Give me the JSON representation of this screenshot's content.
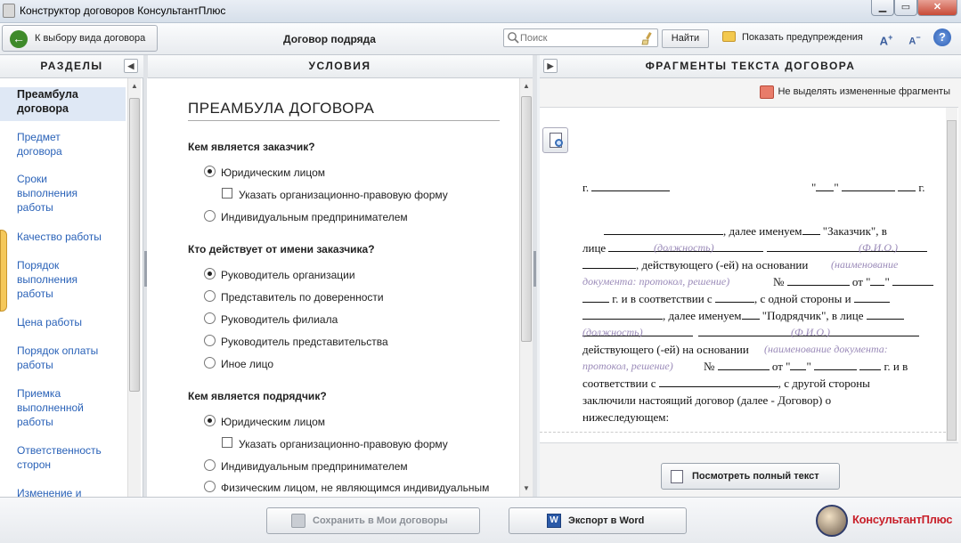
{
  "window": {
    "title": "Конструктор договоров КонсультантПлюс"
  },
  "toolbar": {
    "back_label": "К выбору вида договора",
    "contract_title": "Договор подряда",
    "search_placeholder": "Поиск",
    "find_label": "Найти",
    "warnings_label": "Показать предупреждения"
  },
  "panels": {
    "left_title": "РАЗДЕЛЫ",
    "middle_title": "УСЛОВИЯ",
    "right_title": "ФРАГМЕНТЫ ТЕКСТА ДОГОВОРА"
  },
  "sections": [
    {
      "label": "Преамбула договора",
      "active": true
    },
    {
      "label": "Предмет договора"
    },
    {
      "label": "Сроки выполнения работы"
    },
    {
      "label": "Качество работы"
    },
    {
      "label": "Порядок выполнения работы"
    },
    {
      "label": "Цена работы"
    },
    {
      "label": "Порядок оплаты работы"
    },
    {
      "label": "Приемка выполненной работы"
    },
    {
      "label": "Ответственность сторон"
    },
    {
      "label": "Изменение и"
    }
  ],
  "conditions": {
    "title": "ПРЕАМБУЛА ДОГОВОРА",
    "q1": "Кем является заказчик?",
    "q1_opt1": "Юридическим лицом",
    "q1_chk": "Указать организационно-правовую форму",
    "q1_opt2": "Индивидуальным предпринимателем",
    "q2": "Кто действует от имени заказчика?",
    "q2_opt1": "Руководитель организации",
    "q2_opt2": "Представитель по доверенности",
    "q2_opt3": "Руководитель филиала",
    "q2_opt4": "Руководитель представительства",
    "q2_opt5": "Иное лицо",
    "q3": "Кем является подрядчик?",
    "q3_opt1": "Юридическим лицом",
    "q3_chk": "Указать организационно-правовую форму",
    "q3_opt2": "Индивидуальным предпринимателем",
    "q3_opt3": "Физическим лицом, не являющимся индивидуальным"
  },
  "fragments": {
    "highlight_toggle": "Не выделять измененные фрагменты",
    "g": "г.",
    "quote": "\"",
    "l2": ", далее именуем",
    "l2b": "\"Заказчик\", в",
    "l3a": "лице",
    "ph_position": "(должность)",
    "ph_fio": "(Ф.И.О.)",
    "l4": ", действующего (-ей) на основании",
    "ph_doc1": "(наименование",
    "ph_doc2": "документа: протокол, решение)",
    "num": "№",
    "from": "от",
    "l6": "г. и в соответствии с",
    "l6b": ", с одной стороны и",
    "l7": ", далее именуем",
    "l7b": "\"Подрядчик\", в лице",
    "l9": "действующего (-ей) на основании",
    "ph_doc3": "(наименование документа:",
    "ph_doc4": "протокол, решение)",
    "l10b": "г. и в",
    "l11": "соответствии с",
    "l11b": ", с другой стороны",
    "l12": "заключили настоящий договор (далее - Договор) о",
    "l13": "нижеследующем:",
    "fulltext_label": "Посмотреть полный текст"
  },
  "bottom": {
    "save_label": "Сохранить в Мои договоры",
    "export_label": "Экспорт в Word",
    "logo_text": "КонсультантПлюс"
  }
}
